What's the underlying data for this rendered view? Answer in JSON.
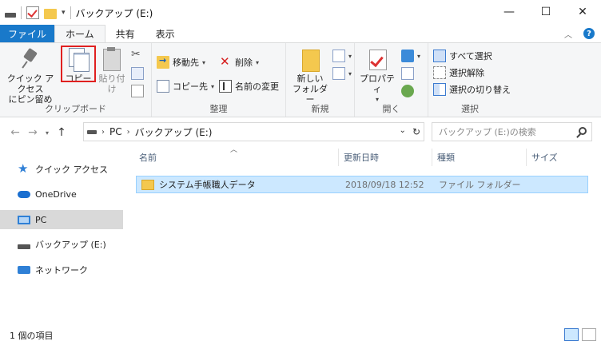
{
  "window": {
    "title": "バックアップ (E:)",
    "controls": [
      "—",
      "☐",
      "✕"
    ]
  },
  "quick_access_toolbar": {
    "dropdown": "▾"
  },
  "tabs": [
    {
      "label": "ファイル"
    },
    {
      "label": "ホーム"
    },
    {
      "label": "共有"
    },
    {
      "label": "表示"
    }
  ],
  "ribbon": {
    "clipboard": {
      "pin_label_1": "クイック アクセス",
      "pin_label_2": "にピン留め",
      "copy_label": "コピー",
      "paste_label": "貼り付け",
      "group_label": "クリップボード"
    },
    "organize": {
      "move_to": "移動先",
      "copy_to": "コピー先",
      "delete": "削除",
      "rename": "名前の変更",
      "group_label": "整理"
    },
    "new": {
      "new_folder_1": "新しい",
      "new_folder_2": "フォルダー",
      "group_label": "新規"
    },
    "open": {
      "properties": "プロパティ",
      "group_label": "開く"
    },
    "select": {
      "select_all": "すべて選択",
      "select_none": "選択解除",
      "invert": "選択の切り替え",
      "group_label": "選択"
    }
  },
  "address_bar": {
    "crumbs": [
      "PC",
      "バックアップ (E:)"
    ],
    "search_placeholder": "バックアップ (E:)の検索"
  },
  "nav_pane": {
    "items": [
      {
        "label": "クイック アクセス",
        "icon": "star-icon"
      },
      {
        "label": "OneDrive",
        "icon": "cloud-icon"
      },
      {
        "label": "PC",
        "icon": "pc-icon",
        "selected": true
      },
      {
        "label": "バックアップ (E:)",
        "icon": "drive-icon"
      },
      {
        "label": "ネットワーク",
        "icon": "network-icon"
      }
    ]
  },
  "file_list": {
    "columns": [
      "名前",
      "更新日時",
      "種類",
      "サイズ"
    ],
    "rows": [
      {
        "name": "システム手帳職人データ",
        "modified": "2018/09/18 12:52",
        "type": "ファイル フォルダー",
        "size": ""
      }
    ]
  },
  "status_bar": {
    "item_count": "1 個の項目"
  },
  "colors": {
    "file_tab": "#1979ca",
    "selection": "#cce8ff",
    "highlight": "#e02020"
  }
}
